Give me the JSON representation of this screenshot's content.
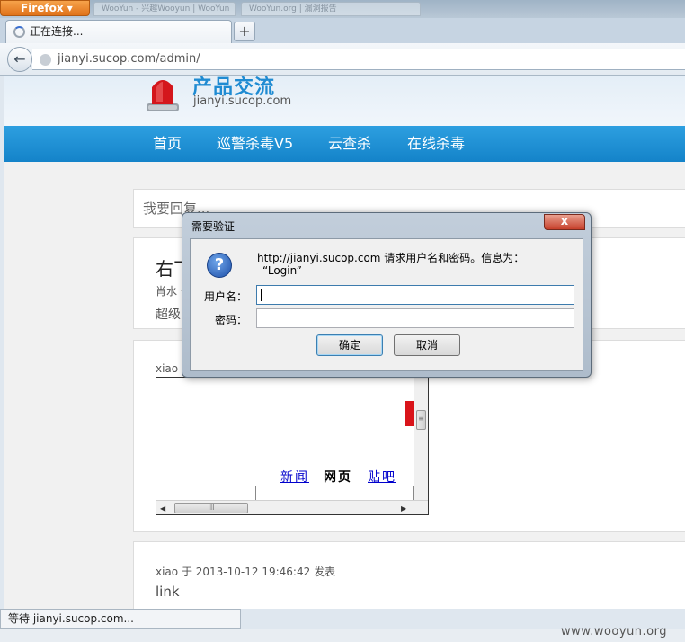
{
  "browser": {
    "menu_button": "Firefox",
    "background_tabs": [
      "WooYun - 兴趣Wooyun | WooYun",
      "WooYun.org | 漏洞报告"
    ],
    "tab_title": "正在连接...",
    "new_tab": "+",
    "url": "jianyi.sucop.com/admin/",
    "status": "等待 jianyi.sucop.com..."
  },
  "site": {
    "title": "产品交流",
    "subtitle": "jianyi.sucop.com",
    "nav": [
      "首页",
      "巡警杀毒V5",
      "云查杀",
      "在线杀毒"
    ]
  },
  "content": {
    "reply_placeholder": "我要回复...",
    "post1_title": "右飞",
    "post1_author": "肖水 于",
    "post1_body": "超级",
    "post2_author": "xiao 于",
    "frame_links": [
      "新闻",
      "网页",
      "贴吧"
    ],
    "post3_meta": "xiao 于 2013-10-12 19:46:42 发表",
    "post3_body": "link"
  },
  "dialog": {
    "title": "需要验证",
    "close": "x",
    "message_line1": "http://jianyi.sucop.com 请求用户名和密码。信息为：",
    "message_line2": "“Login”",
    "username_label": "用户名：",
    "username_value": "",
    "password_label": "密码：",
    "password_value": "",
    "ok": "确定",
    "cancel": "取消"
  },
  "watermark": "www.wooyun.org"
}
